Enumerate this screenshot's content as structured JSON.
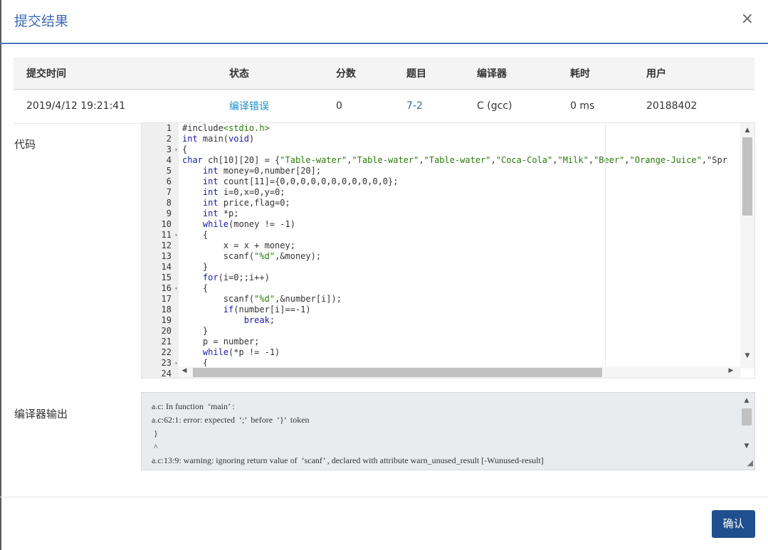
{
  "dialog": {
    "title": "提交结果",
    "close_label": "×"
  },
  "table": {
    "headers": [
      "提交时间",
      "状态",
      "分数",
      "题目",
      "编译器",
      "耗时",
      "用户"
    ],
    "row": {
      "time": "2019/4/12 19:21:41",
      "status": "编译错误",
      "score": "0",
      "problem": "7-2",
      "compiler": "C (gcc)",
      "elapsed": "0 ms",
      "user": "20188402"
    }
  },
  "code_section": {
    "label": "代码",
    "line_numbers": [
      "1",
      "2",
      "3",
      "4",
      "5",
      "6",
      "7",
      "8",
      "9",
      "10",
      "11",
      "12",
      "13",
      "14",
      "15",
      "16",
      "17",
      "18",
      "19",
      "20",
      "21",
      "22",
      "23",
      "24"
    ],
    "lines": [
      "#include<stdio.h>",
      "int main(void)",
      "{",
      "char ch[10][20] = {\"Table-water\",\"Table-water\",\"Table-water\",\"Coca-Cola\",\"Milk\",\"Beer\",\"Orange-Juice\",\"Spr",
      "    int money=0,number[20];",
      "    int count[11]={0,0,0,0,0,0,0,0,0,0,0};",
      "    int i=0,x=0,y=0;",
      "    int price,flag=0;",
      "    int *p;",
      "    while(money != -1)",
      "    {",
      "        x = x + money;",
      "        scanf(\"%d\",&money);",
      "    }",
      "    for(i=0;;i++)",
      "    {",
      "        scanf(\"%d\",&number[i]);",
      "        if(number[i]==-1)",
      "            break;",
      "    }",
      "    p = number;",
      "    while(*p != -1)",
      "    {",
      ""
    ]
  },
  "compiler_output": {
    "label": "编译器输出",
    "lines": [
      "a.c: In function  ‘main’ :",
      "a.c:62:1: error: expected  ‘;’  before  ‘}’  token",
      " }",
      " ^",
      "a.c:13:9: warning: ignoring return value of  ‘scanf’ , declared with attribute warn_unused_result [-Wunused-result]"
    ]
  },
  "footer": {
    "confirm_label": "确认"
  }
}
